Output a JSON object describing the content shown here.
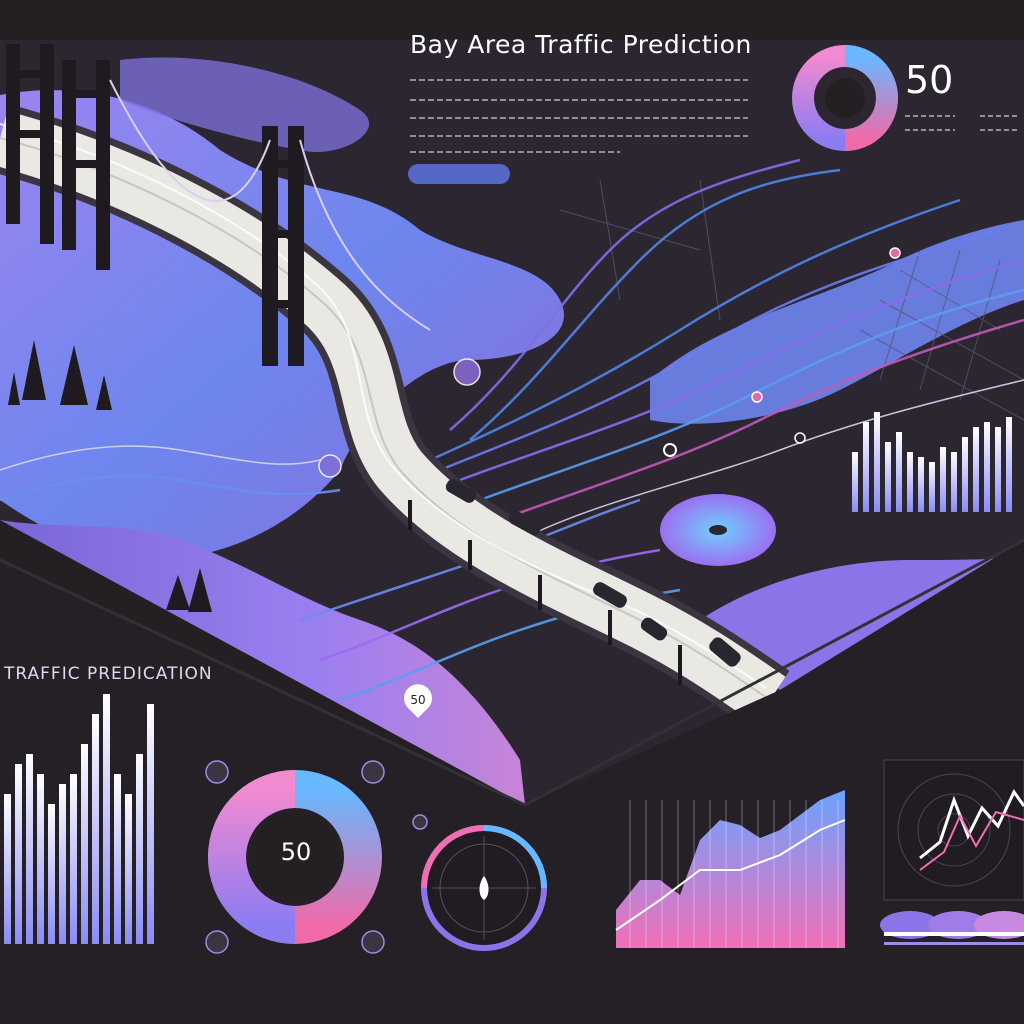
{
  "header": {
    "title": "Bay Area Traffic Prediction"
  },
  "panels": {
    "lower_title": "TRAFFIC PREDICATION",
    "kpi_value": "50",
    "donut_value": "50",
    "map_pin_value": "50"
  },
  "colors": {
    "background": "#231f22",
    "accent_blue": "#5b8df5",
    "accent_purple": "#8b6cf0",
    "accent_pink": "#f06fb4",
    "road": "#eae8e2"
  },
  "icons": [
    "bridge-icon",
    "tree-icon",
    "vehicle-icon",
    "map-pin-icon",
    "compass-icon"
  ]
}
